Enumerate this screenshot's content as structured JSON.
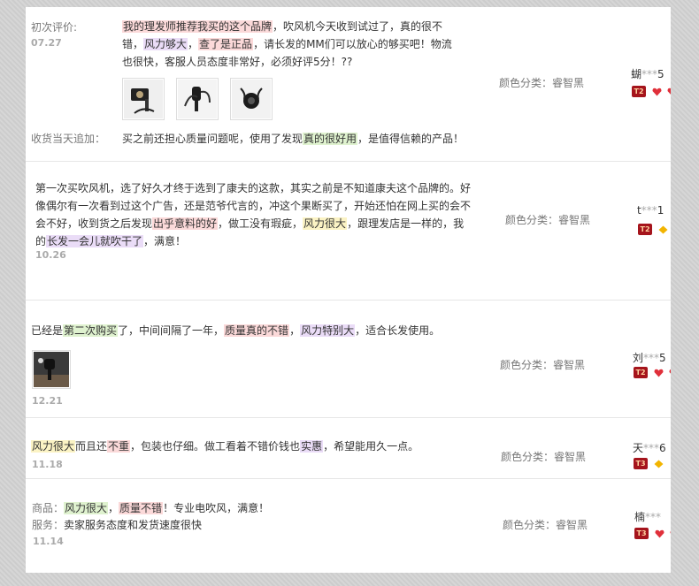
{
  "reviews": [
    {
      "first_label": "初次评价:",
      "date": "07.27",
      "segments": [
        {
          "text": "我的理发师推荐我买的这个品牌",
          "hl": "red"
        },
        {
          "text": "，吹风机今天收到试过了，真的很不错，"
        },
        {
          "text": "风力够大",
          "hl": "purple"
        },
        {
          "text": "，"
        },
        {
          "text": "查了是正品",
          "hl": "red"
        },
        {
          "text": "，请长发的MM们可以放心的够买吧！物流也很快，客服人员态度非常好，必须好评5分！??"
        }
      ],
      "followup_label": "收货当天追加：",
      "followup_segments": [
        {
          "text": "买之前还担心质量问题呢，使用了发现"
        },
        {
          "text": "真的很好用",
          "hl": "green"
        },
        {
          "text": "，是值得信赖的产品！"
        }
      ],
      "sku": "颜色分类：睿智黑",
      "user_prefix": "蝴",
      "user_mask": "***",
      "user_suffix": "5",
      "level": "T2"
    },
    {
      "date": "10.26",
      "segments": [
        {
          "text": "第一次买吹风机，选了好久才终于选到了康夫的这款，其实之前是不知道康夫这个品牌的。好像偶尔有一次看到过这个广告，还是范爷代言的，冲这个果断买了，开始还怕在网上买的会不会不好，收到货之后发现"
        },
        {
          "text": "出乎意料的好",
          "hl": "red"
        },
        {
          "text": "，做工没有瑕疵，"
        },
        {
          "text": "风力很大",
          "hl": "yellow"
        },
        {
          "text": "，跟理发店是一样的，我的"
        },
        {
          "text": "长发一会儿就吹干了",
          "hl": "purple"
        },
        {
          "text": "，满意！"
        }
      ],
      "sku": "颜色分类：睿智黑",
      "user_prefix": "t",
      "user_mask": "***",
      "user_suffix": "1",
      "level": "T2"
    },
    {
      "date": "12.21",
      "segments": [
        {
          "text": "已经是"
        },
        {
          "text": "第二次购买",
          "hl": "green"
        },
        {
          "text": "了，中间间隔了一年，"
        },
        {
          "text": "质量真的不错",
          "hl": "red"
        },
        {
          "text": "，"
        },
        {
          "text": "风力特别大",
          "hl": "purple"
        },
        {
          "text": "，适合长发使用。"
        }
      ],
      "sku": "颜色分类：睿智黑",
      "user_prefix": "刘",
      "user_mask": "***",
      "user_suffix": "5",
      "level": "T2"
    },
    {
      "date": "11.18",
      "segments": [
        {
          "text": "风力很大",
          "hl": "yellow"
        },
        {
          "text": "而且还"
        },
        {
          "text": "不重",
          "hl": "red"
        },
        {
          "text": "，包装也仔细。做工看着不错价钱也"
        },
        {
          "text": "实惠",
          "hl": "purple"
        },
        {
          "text": "，希望能用久一点。"
        }
      ],
      "sku": "颜色分类：睿智黑",
      "user_prefix": "天",
      "user_mask": "***",
      "user_suffix": "6",
      "level": "T3"
    },
    {
      "date": "11.14",
      "line1_label": "商品：",
      "line1_segments": [
        {
          "text": "风力很大",
          "hl": "green"
        },
        {
          "text": "，"
        },
        {
          "text": "质量不错",
          "hl": "red"
        },
        {
          "text": "！专业电吹风，满意！"
        }
      ],
      "line2_label": "服务：",
      "line2_text": "卖家服务态度和发货速度很快",
      "sku": "颜色分类：睿智黑",
      "user_prefix": "楠",
      "user_mask": "***",
      "user_suffix": "",
      "level": "T3"
    }
  ],
  "colors": {
    "highlight_red": "#fbd9d9",
    "highlight_purple": "#eadcf7",
    "highlight_green": "#dff2cf",
    "highlight_yellow": "#fbf3c4",
    "level_badge": "#a5141c"
  },
  "icons": {
    "photo_thumbnail": "product-photo-icon",
    "reputation_red": "red-heart-gem-icon",
    "reputation_gold": "gold-diamond-icon"
  }
}
